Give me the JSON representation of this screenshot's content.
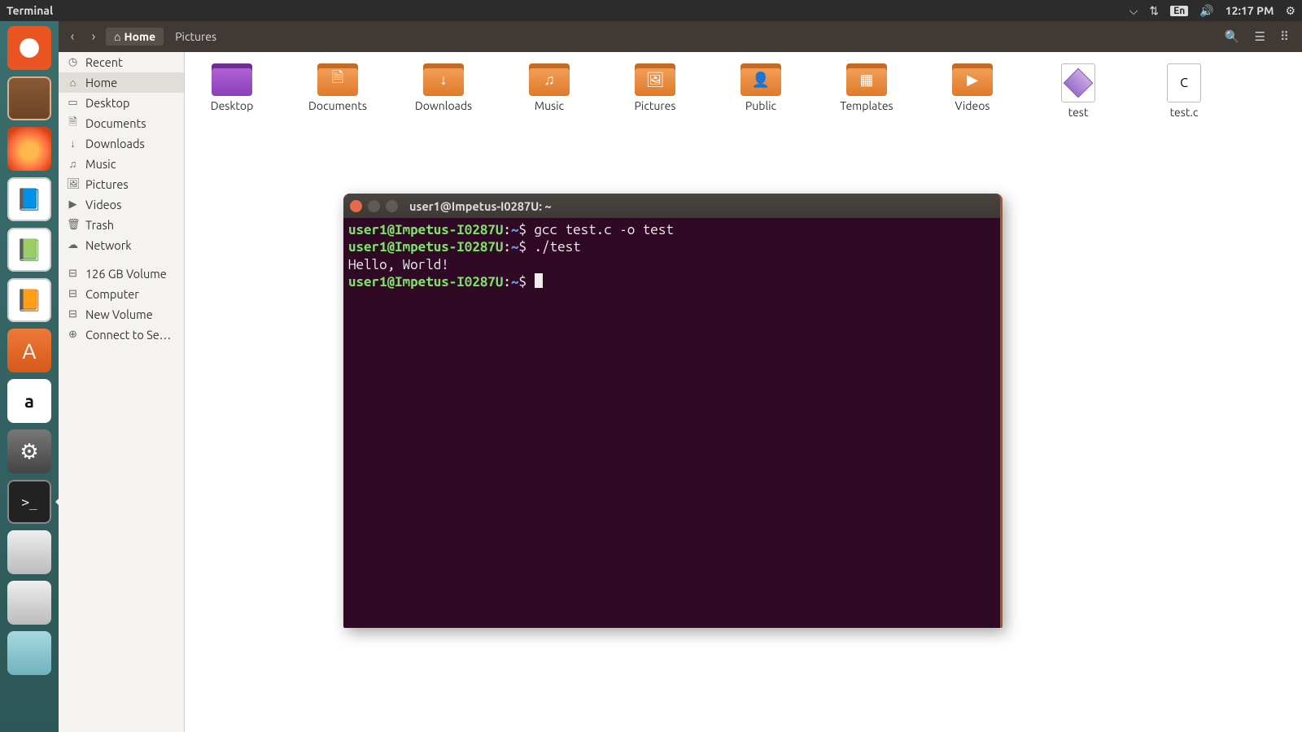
{
  "menubar": {
    "title": "Terminal",
    "lang": "En",
    "clock": "12:17 PM"
  },
  "launcher": [
    {
      "name": "ubuntu-dash",
      "glyph": "◉"
    },
    {
      "name": "files",
      "glyph": "🗄"
    },
    {
      "name": "firefox",
      "glyph": ""
    },
    {
      "name": "writer",
      "glyph": "📄"
    },
    {
      "name": "calc",
      "glyph": "▦"
    },
    {
      "name": "impress",
      "glyph": "▭"
    },
    {
      "name": "software-center",
      "glyph": "A"
    },
    {
      "name": "amazon",
      "glyph": "a"
    },
    {
      "name": "settings",
      "glyph": "⚙"
    },
    {
      "name": "terminal",
      "glyph": ">_"
    },
    {
      "name": "drive-1",
      "glyph": "⌁"
    },
    {
      "name": "drive-2",
      "glyph": "⌁"
    },
    {
      "name": "trash",
      "glyph": "🗑"
    }
  ],
  "toolbar": {
    "crumb_home": "Home",
    "crumb_pictures": "Pictures"
  },
  "places": [
    {
      "icon": "◷",
      "label": "Recent"
    },
    {
      "icon": "⌂",
      "label": "Home",
      "selected": true
    },
    {
      "icon": "▭",
      "label": "Desktop"
    },
    {
      "icon": "🗎",
      "label": "Documents"
    },
    {
      "icon": "↓",
      "label": "Downloads"
    },
    {
      "icon": "♫",
      "label": "Music"
    },
    {
      "icon": "🖼",
      "label": "Pictures"
    },
    {
      "icon": "▶",
      "label": "Videos"
    },
    {
      "icon": "🗑",
      "label": "Trash"
    },
    {
      "icon": "☁",
      "label": "Network"
    }
  ],
  "devices": [
    {
      "icon": "⊟",
      "label": "126 GB Volume"
    },
    {
      "icon": "⊟",
      "label": "Computer"
    },
    {
      "icon": "⊟",
      "label": "New Volume"
    },
    {
      "icon": "⊕",
      "label": "Connect to Se…"
    }
  ],
  "files": [
    {
      "name": "Desktop",
      "kind": "folder-purple"
    },
    {
      "name": "Documents",
      "kind": "folder",
      "glyph": "🗎"
    },
    {
      "name": "Downloads",
      "kind": "folder",
      "glyph": "↓"
    },
    {
      "name": "Music",
      "kind": "folder",
      "glyph": "♫"
    },
    {
      "name": "Pictures",
      "kind": "folder",
      "glyph": "🖼"
    },
    {
      "name": "Public",
      "kind": "folder",
      "glyph": "👤"
    },
    {
      "name": "Templates",
      "kind": "folder",
      "glyph": "▦"
    },
    {
      "name": "Videos",
      "kind": "folder",
      "glyph": "▶"
    },
    {
      "name": "test",
      "kind": "exec"
    },
    {
      "name": "test.c",
      "kind": "cfile"
    }
  ],
  "terminal": {
    "title": "user1@Impetus-I0287U: ~",
    "prompt_user": "user1@Impetus-I0287U",
    "prompt_path": "~",
    "lines": [
      {
        "cmd": "gcc test.c -o test"
      },
      {
        "cmd": "./test"
      },
      {
        "out": "Hello, World!"
      }
    ]
  }
}
